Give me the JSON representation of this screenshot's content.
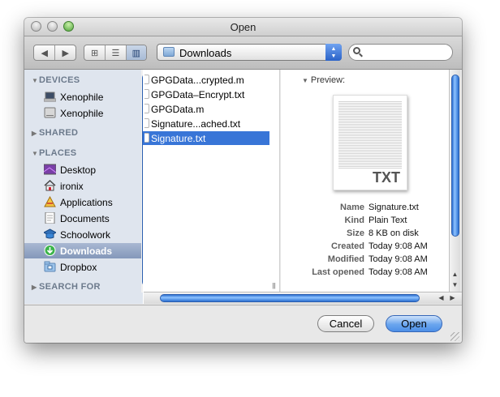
{
  "window": {
    "title": "Open"
  },
  "toolbar": {
    "back_icon": "back-arrow",
    "forward_icon": "forward-arrow",
    "view_modes": [
      {
        "name": "icon-view",
        "glyph": "⊞"
      },
      {
        "name": "list-view",
        "glyph": "☰"
      },
      {
        "name": "column-view",
        "glyph": "▥"
      }
    ],
    "location": "Downloads",
    "search_placeholder": ""
  },
  "sidebar": {
    "sections": {
      "devices": "DEVICES",
      "shared": "SHARED",
      "places": "PLACES",
      "search_for": "SEARCH FOR"
    },
    "devices": [
      "Xenophile",
      "Xenophile"
    ],
    "places": [
      "Desktop",
      "ironix",
      "Applications",
      "Documents",
      "Schoolwork",
      "Downloads",
      "Dropbox"
    ],
    "selected": "Downloads"
  },
  "files": {
    "items": [
      "GPGData...crypted.m",
      "GPGData–Encrypt.txt",
      "GPGData.m",
      "Signature...ached.txt",
      "Signature.txt"
    ],
    "selected": "Signature.txt"
  },
  "preview": {
    "header": "Preview:",
    "thumb_label": "TXT",
    "meta": [
      {
        "key": "Name",
        "value": "Signature.txt"
      },
      {
        "key": "Kind",
        "value": "Plain Text"
      },
      {
        "key": "Size",
        "value": "8 KB on disk"
      },
      {
        "key": "Created",
        "value": "Today 9:08 AM"
      },
      {
        "key": "Modified",
        "value": "Today 9:08 AM"
      },
      {
        "key": "Last opened",
        "value": "Today 9:08 AM"
      }
    ]
  },
  "buttons": {
    "cancel": "Cancel",
    "open": "Open"
  },
  "colors": {
    "selection": "#3875d7",
    "sidebar_selection": "#8498ba",
    "default_button": "#4d8fe7"
  }
}
